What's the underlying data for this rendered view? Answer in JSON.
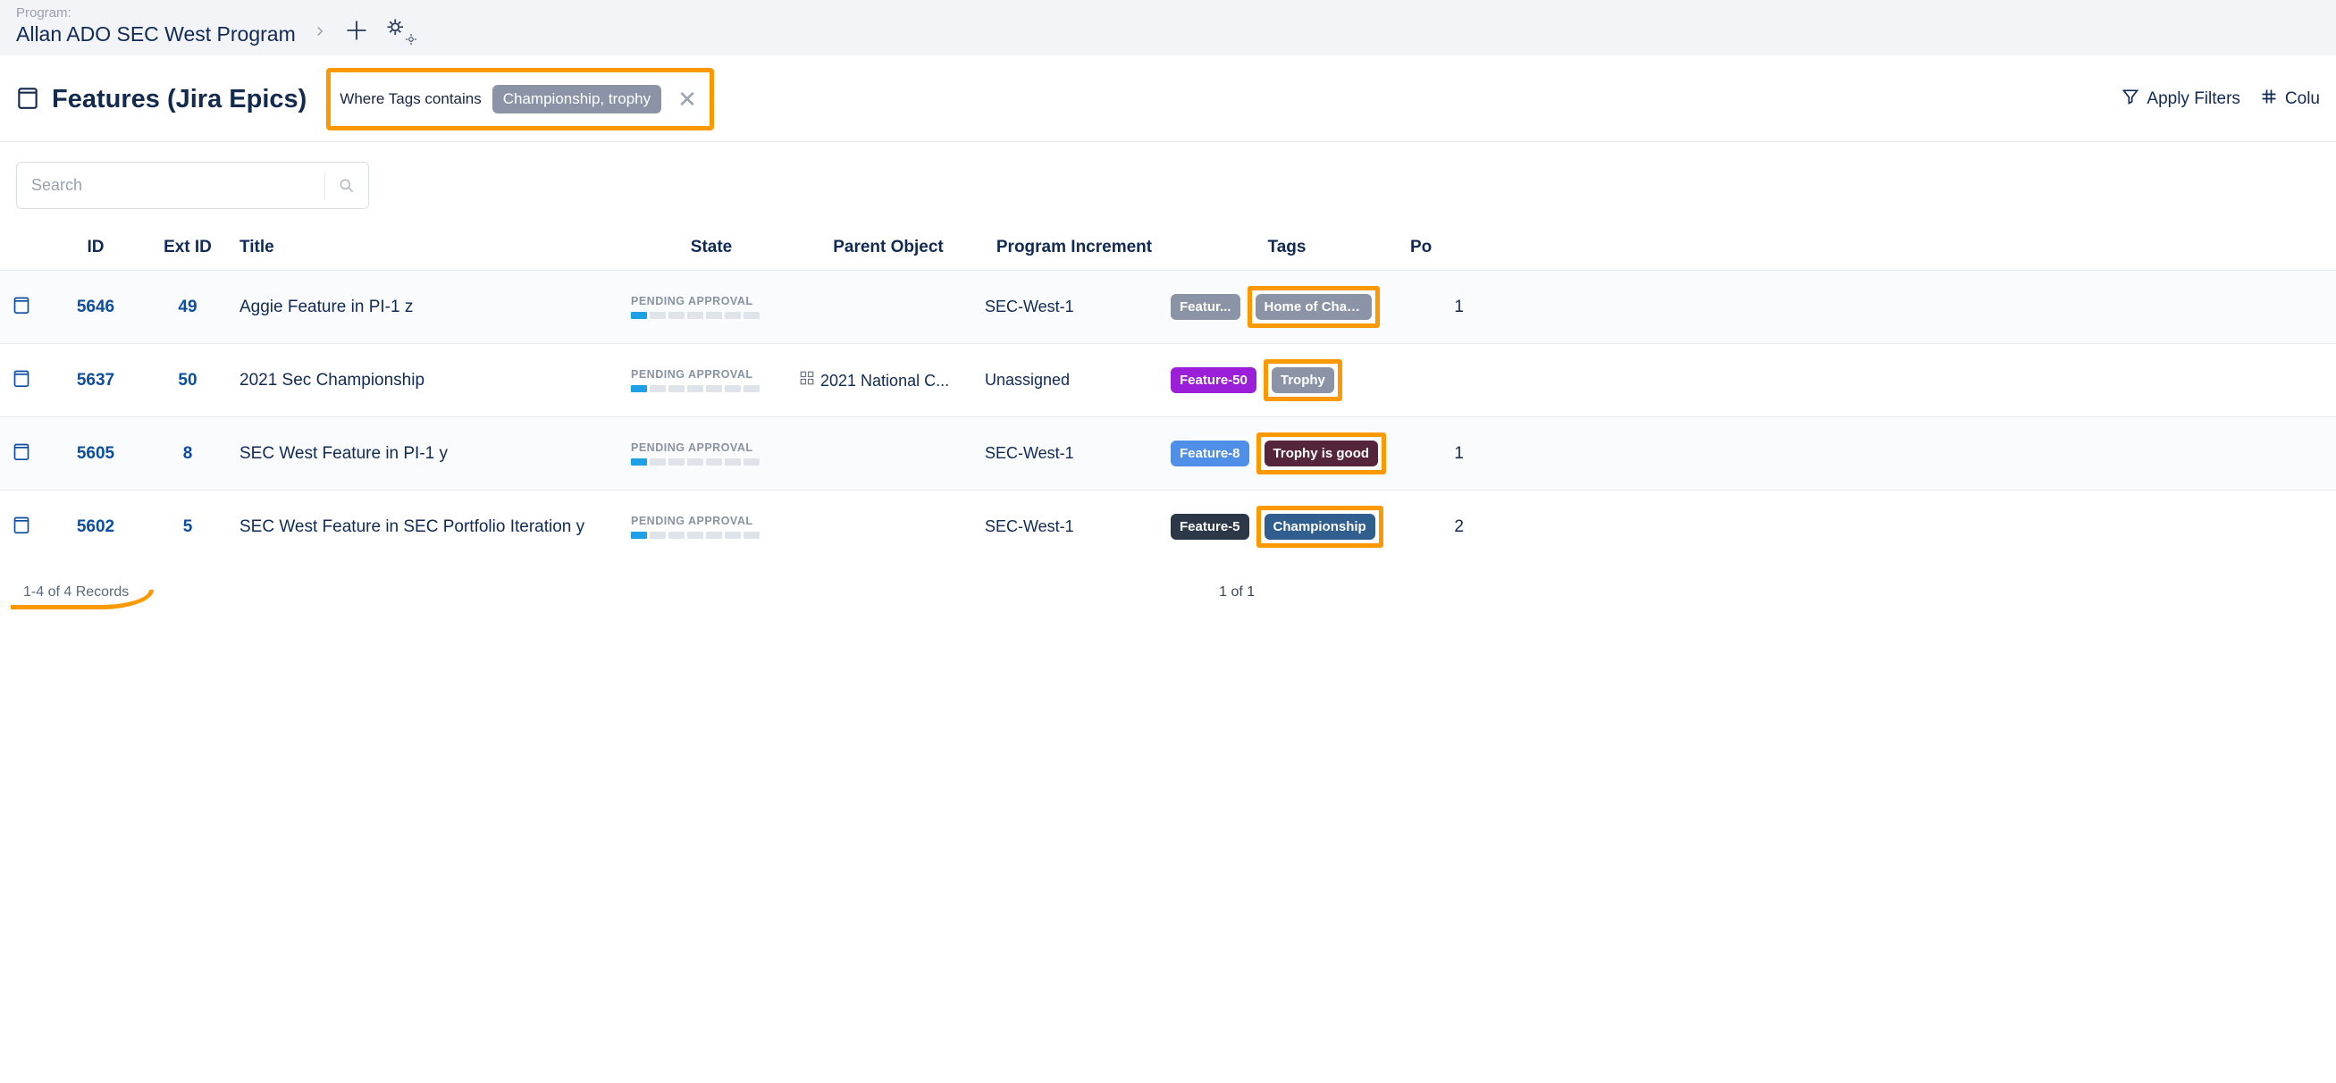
{
  "breadcrumb": {
    "label": "Program:",
    "value": "Allan ADO SEC West Program"
  },
  "page": {
    "title": "Features (Jira Epics)"
  },
  "filter": {
    "prefix": "Where Tags contains",
    "chip": "Championship, trophy"
  },
  "actions": {
    "apply_filters": "Apply Filters",
    "columns": "Colu"
  },
  "search": {
    "placeholder": "Search"
  },
  "columns": {
    "id": "ID",
    "ext": "Ext ID",
    "title": "Title",
    "state": "State",
    "parent": "Parent Object",
    "pi": "Program Increment",
    "tags": "Tags",
    "last": "Po"
  },
  "rows": [
    {
      "id": "5646",
      "ext": "49",
      "title": "Aggie Feature in PI-1 z",
      "state": "PENDING APPROVAL",
      "parent": "",
      "pi": "SEC-West-1",
      "tags": [
        {
          "label": "Featur...",
          "color": "#8a94a6"
        },
        {
          "label": "Home of Champi...",
          "color": "#8a94a6",
          "highlighted": true
        }
      ],
      "last": "1"
    },
    {
      "id": "5637",
      "ext": "50",
      "title": "2021 Sec Championship",
      "state": "PENDING APPROVAL",
      "parent": "2021 National C...",
      "pi": "Unassigned",
      "tags": [
        {
          "label": "Feature-50",
          "color": "#9b1fd8"
        },
        {
          "label": "Trophy",
          "color": "#8a94a6",
          "highlighted": true
        }
      ],
      "last": ""
    },
    {
      "id": "5605",
      "ext": "8",
      "title": "SEC West Feature in PI-1 y",
      "state": "PENDING APPROVAL",
      "parent": "",
      "pi": "SEC-West-1",
      "tags": [
        {
          "label": "Feature-8",
          "color": "#4f8fe8"
        },
        {
          "label": "Trophy is good",
          "color": "#55263b",
          "highlighted": true
        }
      ],
      "last": "1"
    },
    {
      "id": "5602",
      "ext": "5",
      "title": "SEC West Feature in SEC Portfolio Iteration y",
      "state": "PENDING APPROVAL",
      "parent": "",
      "pi": "SEC-West-1",
      "tags": [
        {
          "label": "Feature-5",
          "color": "#2c3748"
        },
        {
          "label": "Championship",
          "color": "#2f5e8f",
          "highlighted": true
        }
      ],
      "last": "2"
    }
  ],
  "footer": {
    "records": "1-4 of 4 Records",
    "pager": "1 of 1"
  }
}
